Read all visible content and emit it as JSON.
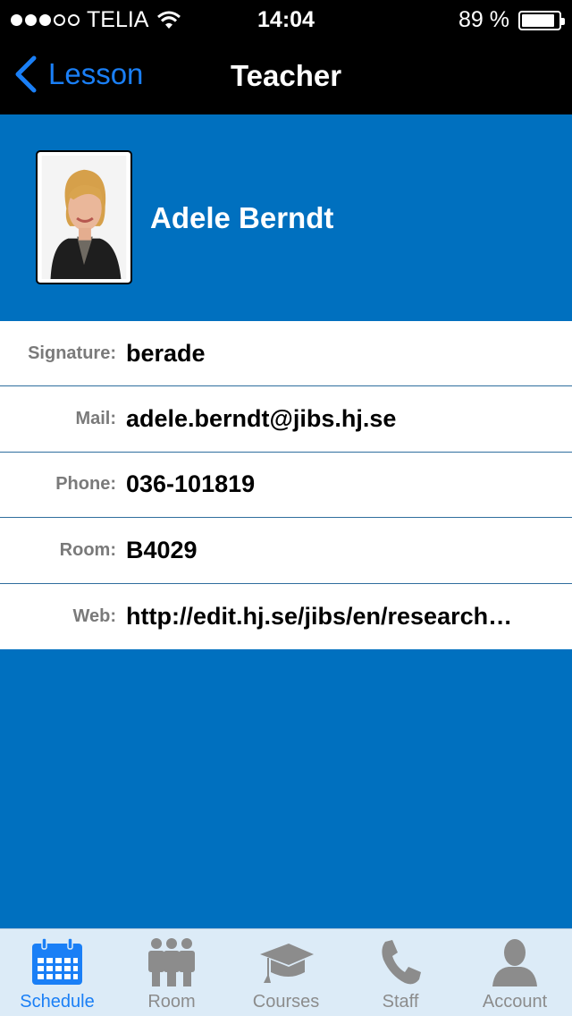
{
  "status": {
    "carrier": "TELIA",
    "time": "14:04",
    "battery": "89 %",
    "battery_level": 0.89
  },
  "navbar": {
    "back_label": "Lesson",
    "title": "Teacher"
  },
  "teacher": {
    "name": "Adele Berndt"
  },
  "details": [
    {
      "key": "Signature:",
      "value": "berade"
    },
    {
      "key": "Mail:",
      "value": "adele.berndt@jibs.hj.se"
    },
    {
      "key": "Phone:",
      "value": "036-101819"
    },
    {
      "key": "Room:",
      "value": "B4029"
    },
    {
      "key": "Web:",
      "value": "http://edit.hj.se/jibs/en/research…"
    }
  ],
  "tabs": [
    {
      "label": "Schedule",
      "icon": "calendar-icon",
      "active": true
    },
    {
      "label": "Room",
      "icon": "people-icon",
      "active": false
    },
    {
      "label": "Courses",
      "icon": "graduation-cap-icon",
      "active": false
    },
    {
      "label": "Staff",
      "icon": "phone-icon",
      "active": false
    },
    {
      "label": "Account",
      "icon": "person-icon",
      "active": false
    }
  ],
  "colors": {
    "accent": "#1a7ff6",
    "brand_blue": "#0070bf",
    "tab_inactive": "#8c8c8c"
  }
}
